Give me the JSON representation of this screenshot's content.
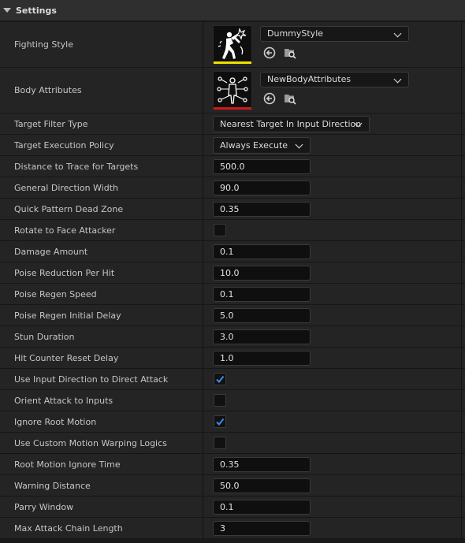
{
  "section": {
    "title": "Settings"
  },
  "colors": {
    "fighting_bar": "#f0e000",
    "body_bar": "#d01818",
    "check": "#3a8ee8"
  },
  "fighting_style": {
    "label": "Fighting Style",
    "value": "DummyStyle",
    "icons": [
      "fighter-thumbnail-icon",
      "use-selected-icon",
      "browse-asset-icon"
    ]
  },
  "body_attributes": {
    "label": "Body Attributes",
    "value": "NewBodyAttributes",
    "icons": [
      "body-attributes-thumbnail-icon",
      "use-selected-icon",
      "browse-asset-icon"
    ]
  },
  "target_filter_type": {
    "label": "Target Filter Type",
    "value": "Nearest Target In Input Direction"
  },
  "target_execution_policy": {
    "label": "Target Execution Policy",
    "value": "Always Execute"
  },
  "rows": [
    {
      "label": "Distance to Trace for Targets",
      "value": "500.0"
    },
    {
      "label": "General Direction Width",
      "value": "90.0"
    },
    {
      "label": "Quick Pattern Dead Zone",
      "value": "0.35"
    },
    {
      "label": "Rotate to Face Attacker",
      "checked": false
    },
    {
      "label": "Damage Amount",
      "value": "0.1"
    },
    {
      "label": "Poise Reduction Per Hit",
      "value": "10.0"
    },
    {
      "label": "Poise Regen Speed",
      "value": "0.1"
    },
    {
      "label": "Poise Regen Initial Delay",
      "value": "5.0"
    },
    {
      "label": "Stun Duration",
      "value": "3.0"
    },
    {
      "label": "Hit Counter Reset Delay",
      "value": "1.0"
    },
    {
      "label": "Use Input Direction to Direct Attack",
      "checked": true
    },
    {
      "label": "Orient Attack to Inputs",
      "checked": false
    },
    {
      "label": "Ignore Root Motion",
      "checked": true
    },
    {
      "label": "Use Custom Motion Warping Logics",
      "checked": false
    },
    {
      "label": "Root Motion Ignore Time",
      "value": "0.35"
    },
    {
      "label": "Warning Distance",
      "value": "50.0"
    },
    {
      "label": "Parry Window",
      "value": "0.1"
    },
    {
      "label": "Max Attack Chain Length",
      "value": "3"
    }
  ]
}
